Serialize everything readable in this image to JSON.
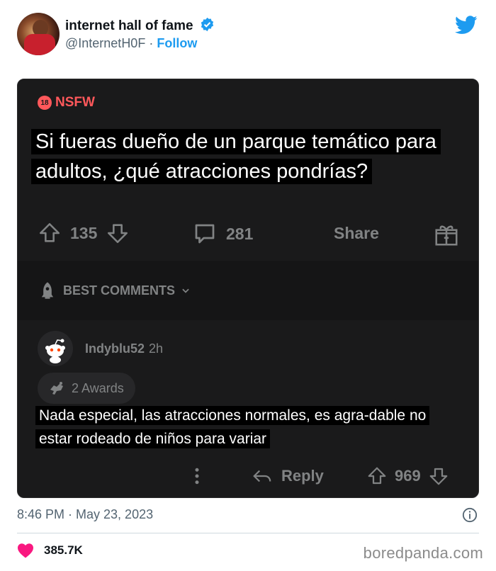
{
  "tweet": {
    "author_name": "internet hall of fame",
    "handle": "@InternetH0F",
    "separator": "·",
    "follow_label": "Follow",
    "timestamp": "8:46 PM · May 23, 2023",
    "likes": "385.7K"
  },
  "post": {
    "nsfw_badge": "18",
    "nsfw_label": "NSFW",
    "title": "Si fueras dueño de un parque temático para adultos, ¿qué atracciones pondrías?",
    "upvotes": "135",
    "comments": "281",
    "share_label": "Share",
    "sort_label": "BEST COMMENTS"
  },
  "comment": {
    "username": "Indyblu52",
    "time": "2h",
    "awards": "2 Awards",
    "text": "Nada especial, las atracciones normales, es agra-dable no estar rodeado de niños para variar",
    "reply_label": "Reply",
    "votes": "969"
  },
  "watermark": "boredpanda.com",
  "colors": {
    "twitter_blue": "#1d9bf0",
    "nsfw_red": "#ff585b",
    "card_bg": "#1a1a1b",
    "like_pink": "#f91880"
  },
  "icons": [
    "verified-icon",
    "twitter-bird-icon",
    "upvote-icon",
    "downvote-icon",
    "comment-icon",
    "gift-icon",
    "rocket-icon",
    "chevron-down-icon",
    "reddit-snoo-icon",
    "award-icon",
    "more-icon",
    "reply-icon",
    "info-icon",
    "heart-icon"
  ]
}
